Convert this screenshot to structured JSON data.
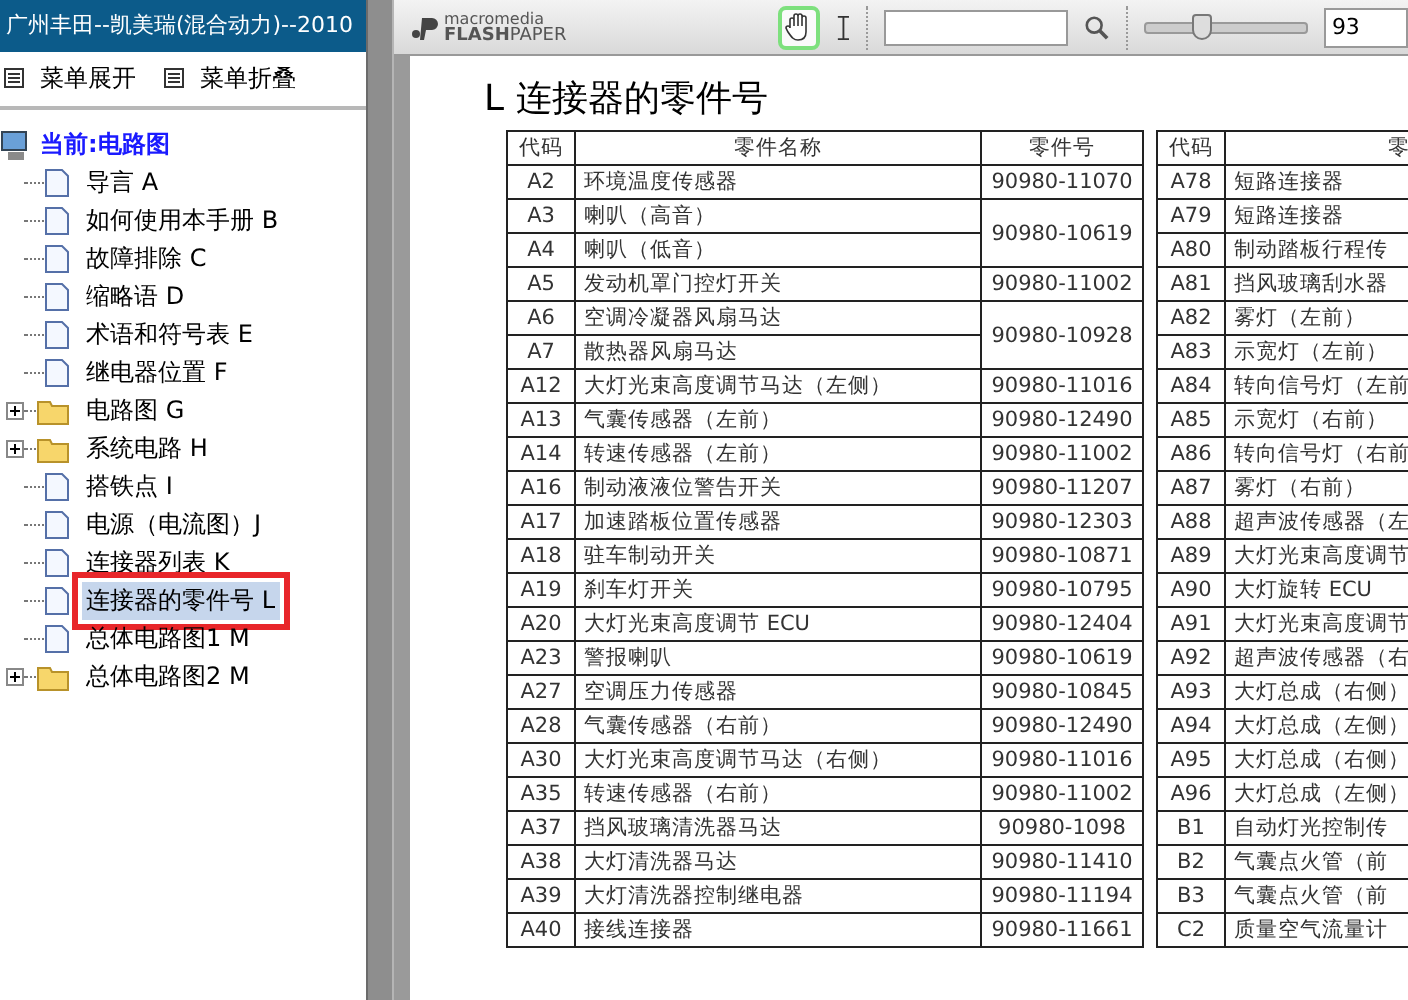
{
  "window": {
    "title": "广州丰田--凯美瑞(混合动力)--2010"
  },
  "menu_actions": [
    "菜单展开",
    "菜单折叠"
  ],
  "tree": {
    "root": "当前:电路图",
    "items": [
      {
        "kind": "doc",
        "label": "导言 A",
        "selected": false
      },
      {
        "kind": "doc",
        "label": "如何使用本手册 B",
        "selected": false
      },
      {
        "kind": "doc",
        "label": "故障排除 C",
        "selected": false
      },
      {
        "kind": "doc",
        "label": "缩略语 D",
        "selected": false
      },
      {
        "kind": "doc",
        "label": "术语和符号表 E",
        "selected": false
      },
      {
        "kind": "doc",
        "label": "继电器位置 F",
        "selected": false
      },
      {
        "kind": "folder",
        "label": "电路图 G",
        "selected": false,
        "expanded": false
      },
      {
        "kind": "folder",
        "label": "系统电路 H",
        "selected": false,
        "expanded": false
      },
      {
        "kind": "doc",
        "label": "搭铁点 I",
        "selected": false
      },
      {
        "kind": "doc",
        "label": "电源（电流图）J",
        "selected": false
      },
      {
        "kind": "doc",
        "label": "连接器列表 K",
        "selected": false
      },
      {
        "kind": "doc",
        "label": "连接器的零件号 L",
        "selected": true
      },
      {
        "kind": "doc",
        "label": "总体电路图1 M",
        "selected": false
      },
      {
        "kind": "folder",
        "label": "总体电路图2 M",
        "selected": false,
        "expanded": false
      }
    ]
  },
  "viewer": {
    "logo_top": "macromedia",
    "logo_bottom_bold": "FLASH",
    "logo_bottom": "PAPER",
    "hand_tool_selected": true,
    "zoom": {
      "level": 0.35,
      "value": "93"
    }
  },
  "document": {
    "heading": "L 连接器的零件号",
    "left_table": {
      "columns": [
        "代码",
        "零件名称",
        "零件号"
      ],
      "groups": [
        {
          "part_no": "90980-11070",
          "items": [
            {
              "code": "A2",
              "name": "环境温度传感器"
            }
          ]
        },
        {
          "part_no": "90980-10619",
          "items": [
            {
              "code": "A3",
              "name": "喇叭（高音）"
            },
            {
              "code": "A4",
              "name": "喇叭（低音）"
            }
          ]
        },
        {
          "part_no": "90980-11002",
          "items": [
            {
              "code": "A5",
              "name": "发动机罩门控灯开关"
            }
          ]
        },
        {
          "part_no": "90980-10928",
          "items": [
            {
              "code": "A6",
              "name": "空调冷凝器风扇马达"
            },
            {
              "code": "A7",
              "name": "散热器风扇马达"
            }
          ]
        },
        {
          "part_no": "90980-11016",
          "items": [
            {
              "code": "A12",
              "name": "大灯光束高度调节马达（左侧）"
            }
          ]
        },
        {
          "part_no": "90980-12490",
          "items": [
            {
              "code": "A13",
              "name": "气囊传感器（左前）"
            }
          ]
        },
        {
          "part_no": "90980-11002",
          "items": [
            {
              "code": "A14",
              "name": "转速传感器（左前）"
            }
          ]
        },
        {
          "part_no": "90980-11207",
          "items": [
            {
              "code": "A16",
              "name": "制动液液位警告开关"
            }
          ]
        },
        {
          "part_no": "90980-12303",
          "items": [
            {
              "code": "A17",
              "name": "加速踏板位置传感器"
            }
          ]
        },
        {
          "part_no": "90980-10871",
          "items": [
            {
              "code": "A18",
              "name": "驻车制动开关"
            }
          ]
        },
        {
          "part_no": "90980-10795",
          "items": [
            {
              "code": "A19",
              "name": "刹车灯开关"
            }
          ]
        },
        {
          "part_no": "90980-12404",
          "items": [
            {
              "code": "A20",
              "name": "大灯光束高度调节 ECU"
            }
          ]
        },
        {
          "part_no": "90980-10619",
          "items": [
            {
              "code": "A23",
              "name": "警报喇叭"
            }
          ]
        },
        {
          "part_no": "90980-10845",
          "items": [
            {
              "code": "A27",
              "name": "空调压力传感器"
            }
          ]
        },
        {
          "part_no": "90980-12490",
          "items": [
            {
              "code": "A28",
              "name": "气囊传感器（右前）"
            }
          ]
        },
        {
          "part_no": "90980-11016",
          "items": [
            {
              "code": "A30",
              "name": "大灯光束高度调节马达（右侧）"
            }
          ]
        },
        {
          "part_no": "90980-11002",
          "items": [
            {
              "code": "A35",
              "name": "转速传感器（右前）"
            }
          ]
        },
        {
          "part_no": "90980-1098",
          "items": [
            {
              "code": "A37",
              "name": "挡风玻璃清洗器马达"
            }
          ]
        },
        {
          "part_no": "90980-11410",
          "items": [
            {
              "code": "A38",
              "name": "大灯清洗器马达"
            }
          ]
        },
        {
          "part_no": "90980-11194",
          "items": [
            {
              "code": "A39",
              "name": "大灯清洗器控制继电器"
            }
          ]
        },
        {
          "part_no": "90980-11661",
          "items": [
            {
              "code": "A40",
              "name": "接线连接器"
            }
          ]
        }
      ]
    },
    "right_table": {
      "columns": [
        "代码",
        "零"
      ],
      "rows": [
        {
          "code": "A78",
          "name": "短路连接器"
        },
        {
          "code": "A79",
          "name": "短路连接器"
        },
        {
          "code": "A80",
          "name": "制动踏板行程传"
        },
        {
          "code": "A81",
          "name": "挡风玻璃刮水器"
        },
        {
          "code": "A82",
          "name": "雾灯（左前）"
        },
        {
          "code": "A83",
          "name": "示宽灯（左前）"
        },
        {
          "code": "A84",
          "name": "转向信号灯（左前"
        },
        {
          "code": "A85",
          "name": "示宽灯（右前）"
        },
        {
          "code": "A86",
          "name": "转向信号灯（右前"
        },
        {
          "code": "A87",
          "name": "雾灯（右前）"
        },
        {
          "code": "A88",
          "name": "超声波传感器（左"
        },
        {
          "code": "A89",
          "name": "大灯光束高度调节"
        },
        {
          "code": "A90",
          "name": "大灯旋转 ECU"
        },
        {
          "code": "A91",
          "name": "大灯光束高度调节"
        },
        {
          "code": "A92",
          "name": "超声波传感器（右"
        },
        {
          "code": "A93",
          "name": "大灯总成（右侧）"
        },
        {
          "code": "A94",
          "name": "大灯总成（左侧）"
        },
        {
          "code": "A95",
          "name": "大灯总成（右侧）"
        },
        {
          "code": "A96",
          "name": "大灯总成（左侧）"
        },
        {
          "code": "B1",
          "name": "自动灯光控制传"
        },
        {
          "code": "B2",
          "name": "气囊点火管（前"
        },
        {
          "code": "B3",
          "name": "气囊点火管（前"
        },
        {
          "code": "C2",
          "name": "质量空气流量计"
        }
      ]
    }
  }
}
